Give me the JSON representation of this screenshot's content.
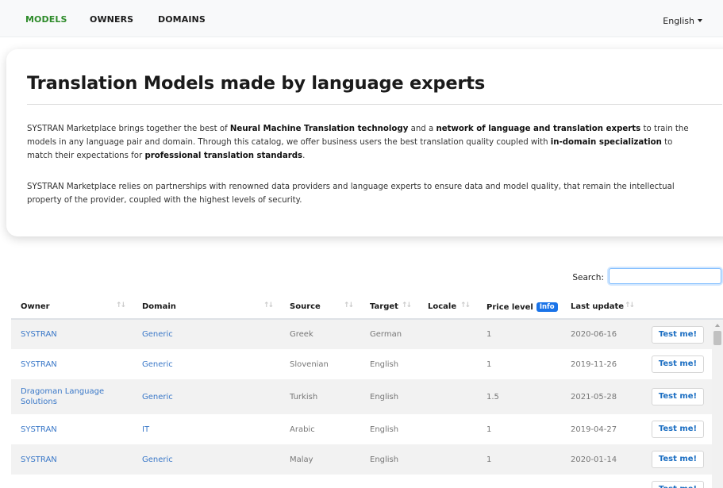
{
  "nav": {
    "items": [
      {
        "label": "MODELS",
        "active": true
      },
      {
        "label": "OWNERS",
        "active": false
      },
      {
        "label": "DOMAINS",
        "active": false
      }
    ],
    "language": "English"
  },
  "hero": {
    "title": "Translation Models made by language experts",
    "para1": [
      {
        "text": "SYSTRAN Marketplace brings together the best of ",
        "bold": false
      },
      {
        "text": "Neural Machine Translation technology",
        "bold": true
      },
      {
        "text": " and a ",
        "bold": false
      },
      {
        "text": "network of language and translation experts",
        "bold": true
      },
      {
        "text": " to train the models in any language pair and domain. Through this catalog, we offer business users the best translation quality coupled with ",
        "bold": false
      },
      {
        "text": "in-domain specialization",
        "bold": true
      },
      {
        "text": " to match their expectations for ",
        "bold": false
      },
      {
        "text": "professional translation standards",
        "bold": true
      },
      {
        "text": ".",
        "bold": false
      }
    ],
    "para2": "SYSTRAN Marketplace relies on partnerships with renowned data providers and language experts to ensure data and model quality, that remain the intellectual property of the provider, coupled with the highest levels of security."
  },
  "search": {
    "label": "Search:",
    "value": "",
    "placeholder": ""
  },
  "table": {
    "headers": {
      "owner": "Owner",
      "domain": "Domain",
      "source": "Source",
      "target": "Target",
      "locale": "Locale",
      "price": "Price level",
      "price_info": "Info",
      "last_update": "Last update"
    },
    "test_label": "Test me!",
    "rows": [
      {
        "owner": "SYSTRAN",
        "domain": "Generic",
        "source": "Greek",
        "target": "German",
        "locale": "",
        "price": "1",
        "last_update": "2020-06-16"
      },
      {
        "owner": "SYSTRAN",
        "domain": "Generic",
        "source": "Slovenian",
        "target": "English",
        "locale": "",
        "price": "1",
        "last_update": "2019-11-26"
      },
      {
        "owner": "Dragoman Language Solutions",
        "domain": "Generic",
        "source": "Turkish",
        "target": "English",
        "locale": "",
        "price": "1.5",
        "last_update": "2021-05-28"
      },
      {
        "owner": "SYSTRAN",
        "domain": "IT",
        "source": "Arabic",
        "target": "English",
        "locale": "",
        "price": "1",
        "last_update": "2019-04-27"
      },
      {
        "owner": "SYSTRAN",
        "domain": "Generic",
        "source": "Malay",
        "target": "English",
        "locale": "",
        "price": "1",
        "last_update": "2020-01-14"
      },
      {
        "owner": "",
        "domain": "",
        "source": "",
        "target": "",
        "locale": "",
        "price": "",
        "last_update": ""
      }
    ]
  }
}
